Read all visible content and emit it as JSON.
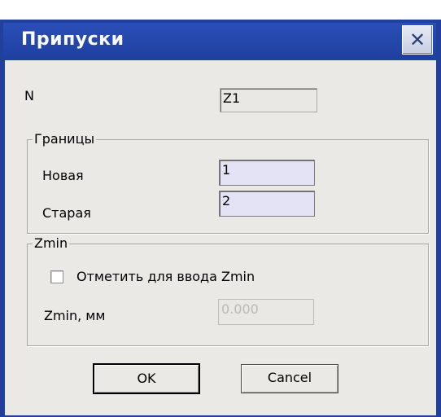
{
  "window": {
    "title": "Припуски",
    "close_label": "✕"
  },
  "form": {
    "n_label": "N",
    "n_value": "Z1",
    "bounds_group": {
      "title": "Границы",
      "new_label": "Новая",
      "new_value": "1",
      "old_label": "Старая",
      "old_value": "2"
    },
    "zmin_group": {
      "title": "Zmin",
      "checkbox_label": "Отметить для ввода Zmin",
      "checkbox_checked": false,
      "zmin_label": "Zmin, мм",
      "zmin_value": "0.000"
    }
  },
  "buttons": {
    "ok_label": "OK",
    "cancel_label": "Cancel"
  },
  "colors": {
    "title_bar": "#21409b",
    "dialog_bg": "#ebe9e6",
    "editable_field_bg": "#e4e3f6"
  }
}
